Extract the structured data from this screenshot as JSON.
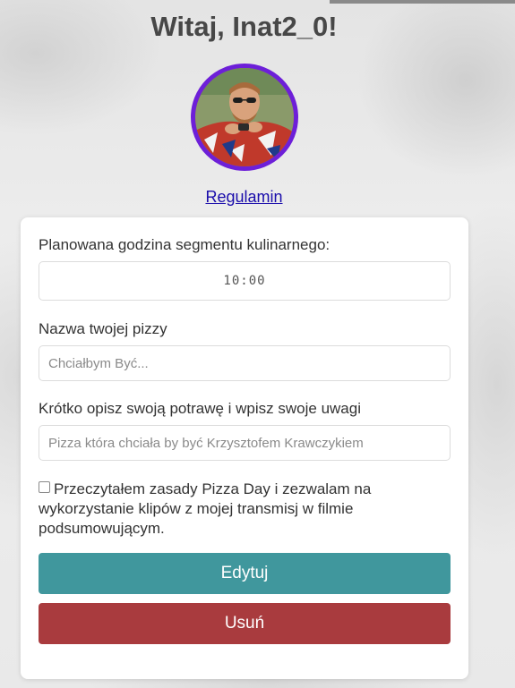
{
  "header": {
    "greeting": "Witaj, Inat2_0!",
    "terms_link": "Regulamin"
  },
  "form": {
    "time_label": "Planowana godzina segmentu kulinarnego:",
    "time_value": "10:00",
    "pizza_name_label": "Nazwa twojej pizzy",
    "pizza_name_placeholder": "Chciałbym Być...",
    "description_label": "Krótko opisz swoją potrawę i wpisz swoje uwagi",
    "description_placeholder": "Pizza która chciała by być Krzysztofem Krawczykiem",
    "consent_text": "Przeczytałem zasady Pizza Day i zezwalam na wykorzystanie klipów z mojej transmisj w filmie podsumowującym.",
    "consent_checked": false,
    "edit_button": "Edytuj",
    "delete_button": "Usuń"
  },
  "colors": {
    "avatar_border": "#6d1fd8",
    "edit_button": "#40979d",
    "delete_button": "#a93b3e",
    "link": "#1a0dab"
  },
  "icons": {
    "avatar": "user-avatar-photo",
    "checkbox": "checkbox-unchecked"
  }
}
